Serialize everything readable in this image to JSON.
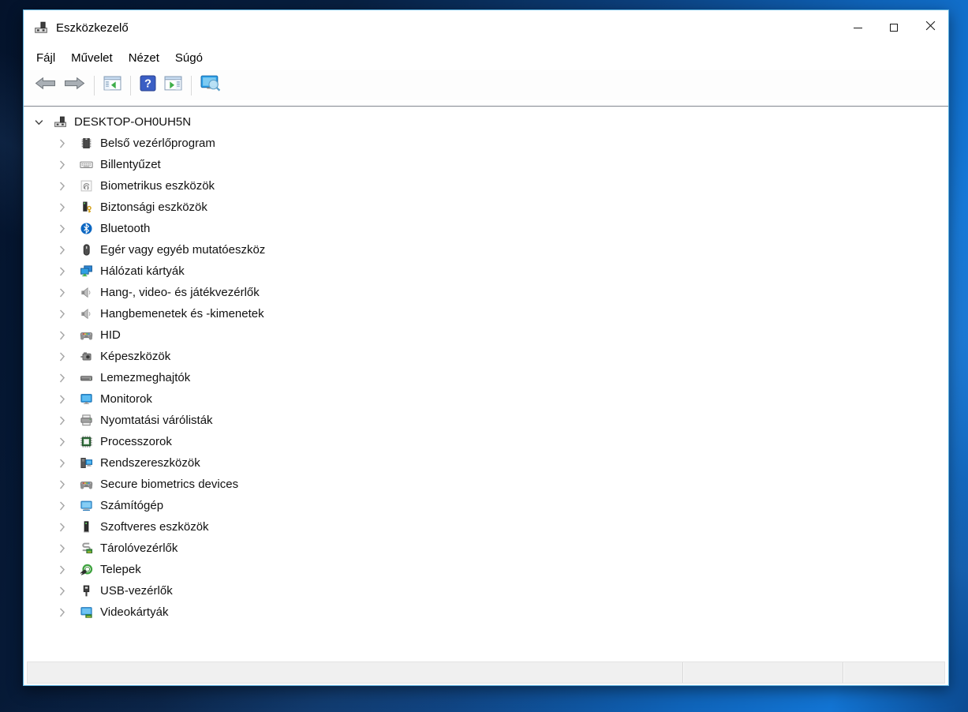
{
  "window": {
    "title": "Eszközkezelő",
    "icon": "device-manager-icon",
    "controls": [
      {
        "name": "minimize-button",
        "icon": "minimize-icon"
      },
      {
        "name": "maximize-button",
        "icon": "maximize-icon"
      },
      {
        "name": "close-button",
        "icon": "close-icon"
      }
    ]
  },
  "menu": {
    "items": [
      {
        "label": "Fájl"
      },
      {
        "label": "Művelet"
      },
      {
        "label": "Nézet"
      },
      {
        "label": "Súgó"
      }
    ]
  },
  "toolbar": {
    "buttons": [
      {
        "name": "back-button",
        "icon": "back-arrow-icon"
      },
      {
        "name": "forward-button",
        "icon": "forward-arrow-icon"
      },
      {
        "name": "console-tree-toggle-button",
        "icon": "console-tree-icon"
      },
      {
        "name": "help-button",
        "icon": "help-icon"
      },
      {
        "name": "action-pane-toggle-button",
        "icon": "action-pane-icon"
      },
      {
        "name": "scan-hardware-changes-button",
        "icon": "scan-hardware-icon"
      }
    ]
  },
  "tree": {
    "root": {
      "label": "DESKTOP-OH0UH5N",
      "icon": "computer-device-icon",
      "state": "expanded"
    },
    "items": [
      {
        "label": "Belső vezérlőprogram",
        "icon": "firmware-icon"
      },
      {
        "label": "Billentyűzet",
        "icon": "keyboard-icon"
      },
      {
        "label": "Biometrikus eszközök",
        "icon": "fingerprint-icon"
      },
      {
        "label": "Biztonsági eszközök",
        "icon": "security-device-icon"
      },
      {
        "label": "Bluetooth",
        "icon": "bluetooth-icon"
      },
      {
        "label": "Egér vagy egyéb mutatóeszköz",
        "icon": "mouse-icon"
      },
      {
        "label": "Hálózati kártyák",
        "icon": "network-adapter-icon"
      },
      {
        "label": "Hang-, video- és játékvezérlők",
        "icon": "speaker-icon"
      },
      {
        "label": "Hangbemenetek és -kimenetek",
        "icon": "audio-io-icon"
      },
      {
        "label": "HID",
        "icon": "gamepad-icon"
      },
      {
        "label": "Képeszközök",
        "icon": "camera-icon"
      },
      {
        "label": "Lemezmeghajtók",
        "icon": "disk-drive-icon"
      },
      {
        "label": "Monitorok",
        "icon": "monitor-icon"
      },
      {
        "label": "Nyomtatási várólisták",
        "icon": "printer-icon"
      },
      {
        "label": "Processzorok",
        "icon": "processor-icon"
      },
      {
        "label": "Rendszereszközök",
        "icon": "system-device-icon"
      },
      {
        "label": "Secure biometrics devices",
        "icon": "gamepad-icon"
      },
      {
        "label": "Számítógép",
        "icon": "computer-monitor-icon"
      },
      {
        "label": "Szoftveres eszközök",
        "icon": "software-device-icon"
      },
      {
        "label": "Tárolóvezérlők",
        "icon": "storage-controller-icon"
      },
      {
        "label": "Telepek",
        "icon": "battery-icon"
      },
      {
        "label": "USB-vezérlők",
        "icon": "usb-icon"
      },
      {
        "label": "Videokártyák",
        "icon": "video-card-icon"
      }
    ]
  },
  "statusbar": {
    "panels": [
      "",
      "",
      ""
    ]
  },
  "colors": {
    "window_border": "#5fb2df",
    "statusbar_bg": "#f0f0f0",
    "help_icon_blue": "#3a5ec4",
    "tree_border": "#828790",
    "desktop_dark": "#04132b",
    "desktop_bright": "#1274d3"
  }
}
